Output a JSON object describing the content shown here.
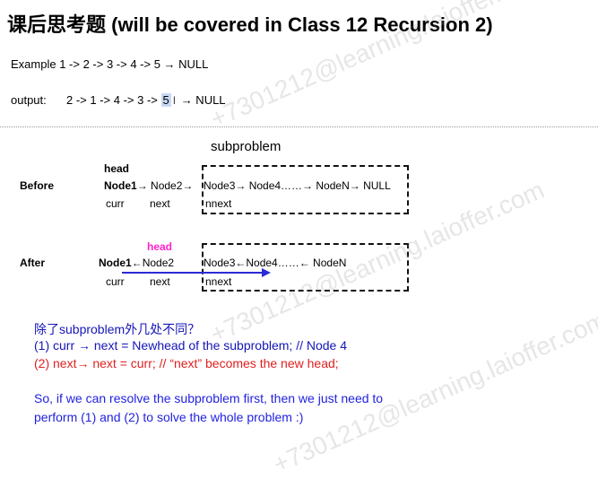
{
  "title": "课后思考题 (will be covered in Class 12 Recursion 2)",
  "example": "Example 1 -> 2 -> 3 -> 4 -> 5 → NULL",
  "output": {
    "label": "output:",
    "before_hl": "2 -> 1 -> 4 -> 3 -> ",
    "highlight": "5",
    "cursor": "I",
    "after_hl": " → NULL"
  },
  "diagram": {
    "subproblem": "subproblem",
    "before": {
      "label": "Before",
      "head": "head",
      "node1": "Node1",
      "rest_outside": "→ Node2→",
      "inside": "Node3→ Node4……→ NodeN→ NULL",
      "curr": "curr",
      "next": "next",
      "nnext": "nnext"
    },
    "after": {
      "label": "After",
      "head": "head",
      "node1": "Node1",
      "rest_outside": "←Node2",
      "inside": "Node3←Node4……←  NodeN",
      "curr": "curr",
      "next": "next",
      "nnext": "nnext"
    }
  },
  "notes": {
    "question": "除了subproblem外几处不同？",
    "line1": "(1) curr → next = Newhead of the subproblem;    // Node 4",
    "line2": "(2) next→ next = curr;              // “next” becomes the new head;",
    "line3": "So, if we can resolve the subproblem first, then we just need to",
    "line4": "perform (1) and (2) to solve the whole problem :)"
  },
  "colors": {
    "blue": "#1f1fe0",
    "red": "#e02020",
    "magenta": "#ff22cc",
    "arrow": "#2b2bd6"
  },
  "watermark": "+7301212@learning.laioffer.com"
}
